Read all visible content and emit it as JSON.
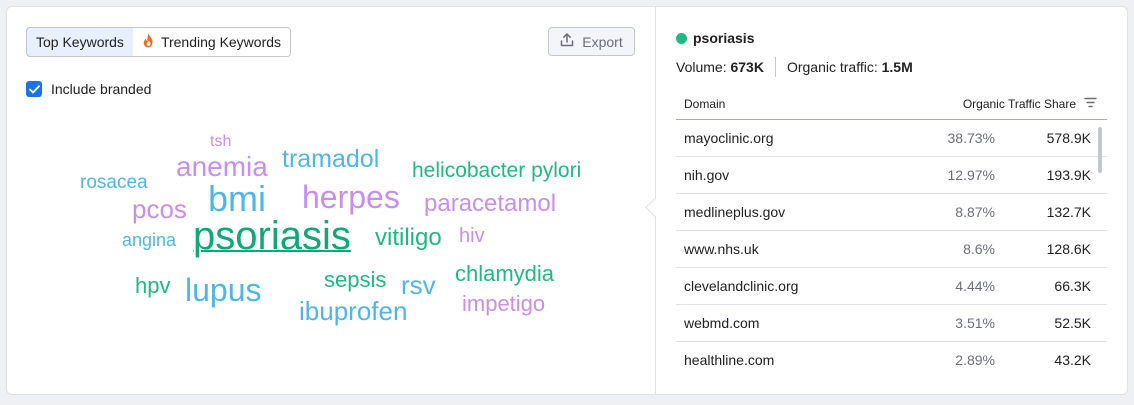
{
  "tabs": {
    "top_keywords": "Top Keywords",
    "trending_keywords": "Trending Keywords"
  },
  "export_label": "Export",
  "include_branded": {
    "label": "Include branded",
    "checked": true
  },
  "word_cloud": [
    {
      "text": "tsh",
      "color": "purple"
    },
    {
      "text": "anemia",
      "color": "purple"
    },
    {
      "text": "tramadol",
      "color": "blue"
    },
    {
      "text": "helicobacter pylori",
      "color": "green"
    },
    {
      "text": "rosacea",
      "color": "blue"
    },
    {
      "text": "bmi",
      "color": "blue"
    },
    {
      "text": "herpes",
      "color": "purple"
    },
    {
      "text": "pcos",
      "color": "purple"
    },
    {
      "text": "paracetamol",
      "color": "purple"
    },
    {
      "text": "angina",
      "color": "blue"
    },
    {
      "text": "psoriasis",
      "color": "green",
      "selected": true
    },
    {
      "text": "vitiligo",
      "color": "green"
    },
    {
      "text": "hiv",
      "color": "purple"
    },
    {
      "text": "sepsis",
      "color": "green"
    },
    {
      "text": "chlamydia",
      "color": "green"
    },
    {
      "text": "hpv",
      "color": "green"
    },
    {
      "text": "lupus",
      "color": "blue"
    },
    {
      "text": "rsv",
      "color": "blue"
    },
    {
      "text": "impetigo",
      "color": "purple"
    },
    {
      "text": "ibuprofen",
      "color": "blue"
    }
  ],
  "colors": {
    "green": "#1fb984",
    "blue": "#4fb6ec",
    "purple": "#c88ef0",
    "accent": "#1a73e8"
  },
  "detail": {
    "keyword": "psoriasis",
    "volume_label": "Volume:",
    "volume_value": "673K",
    "traffic_label": "Organic traffic:",
    "traffic_value": "1.5M",
    "col_domain": "Domain",
    "col_share": "Organic Traffic Share",
    "rows": [
      {
        "domain": "mayoclinic.org",
        "share": "38.73%",
        "traffic": "578.9K"
      },
      {
        "domain": "nih.gov",
        "share": "12.97%",
        "traffic": "193.9K"
      },
      {
        "domain": "medlineplus.gov",
        "share": "8.87%",
        "traffic": "132.7K"
      },
      {
        "domain": "www.nhs.uk",
        "share": "8.6%",
        "traffic": "128.6K"
      },
      {
        "domain": "clevelandclinic.org",
        "share": "4.44%",
        "traffic": "66.3K"
      },
      {
        "domain": "webmd.com",
        "share": "3.51%",
        "traffic": "52.5K"
      },
      {
        "domain": "healthline.com",
        "share": "2.89%",
        "traffic": "43.2K"
      }
    ]
  }
}
